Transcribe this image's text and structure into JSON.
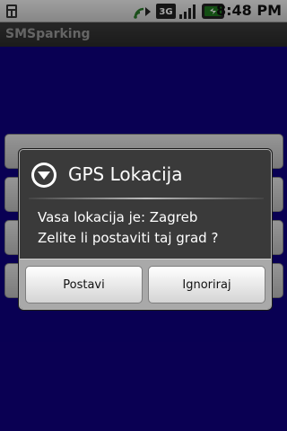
{
  "status_bar": {
    "time": "8:48 PM",
    "icons": [
      "notification-icon",
      "sync-icon",
      "3g-icon",
      "signal-icon",
      "battery-icon"
    ],
    "network_label": "3G"
  },
  "app": {
    "title": "SMSparking",
    "background_color": "#0f0080"
  },
  "dialog": {
    "title": "GPS Lokacija",
    "icon": "info-arrow-icon",
    "message_lines": [
      "Vasa lokacija je: Zagreb",
      "Zelite li postaviti taj grad ?"
    ],
    "positive_button": "Postavi",
    "negative_button": "Ignoriraj"
  },
  "colors": {
    "status_bar": "#dcdcdc",
    "title_bar": "#333333",
    "app_background": "#0f0080",
    "dialog_body": "#3a3a3a",
    "dialog_button_bar": "#a9a9a9",
    "battery_accent": "#1f7a1f"
  }
}
